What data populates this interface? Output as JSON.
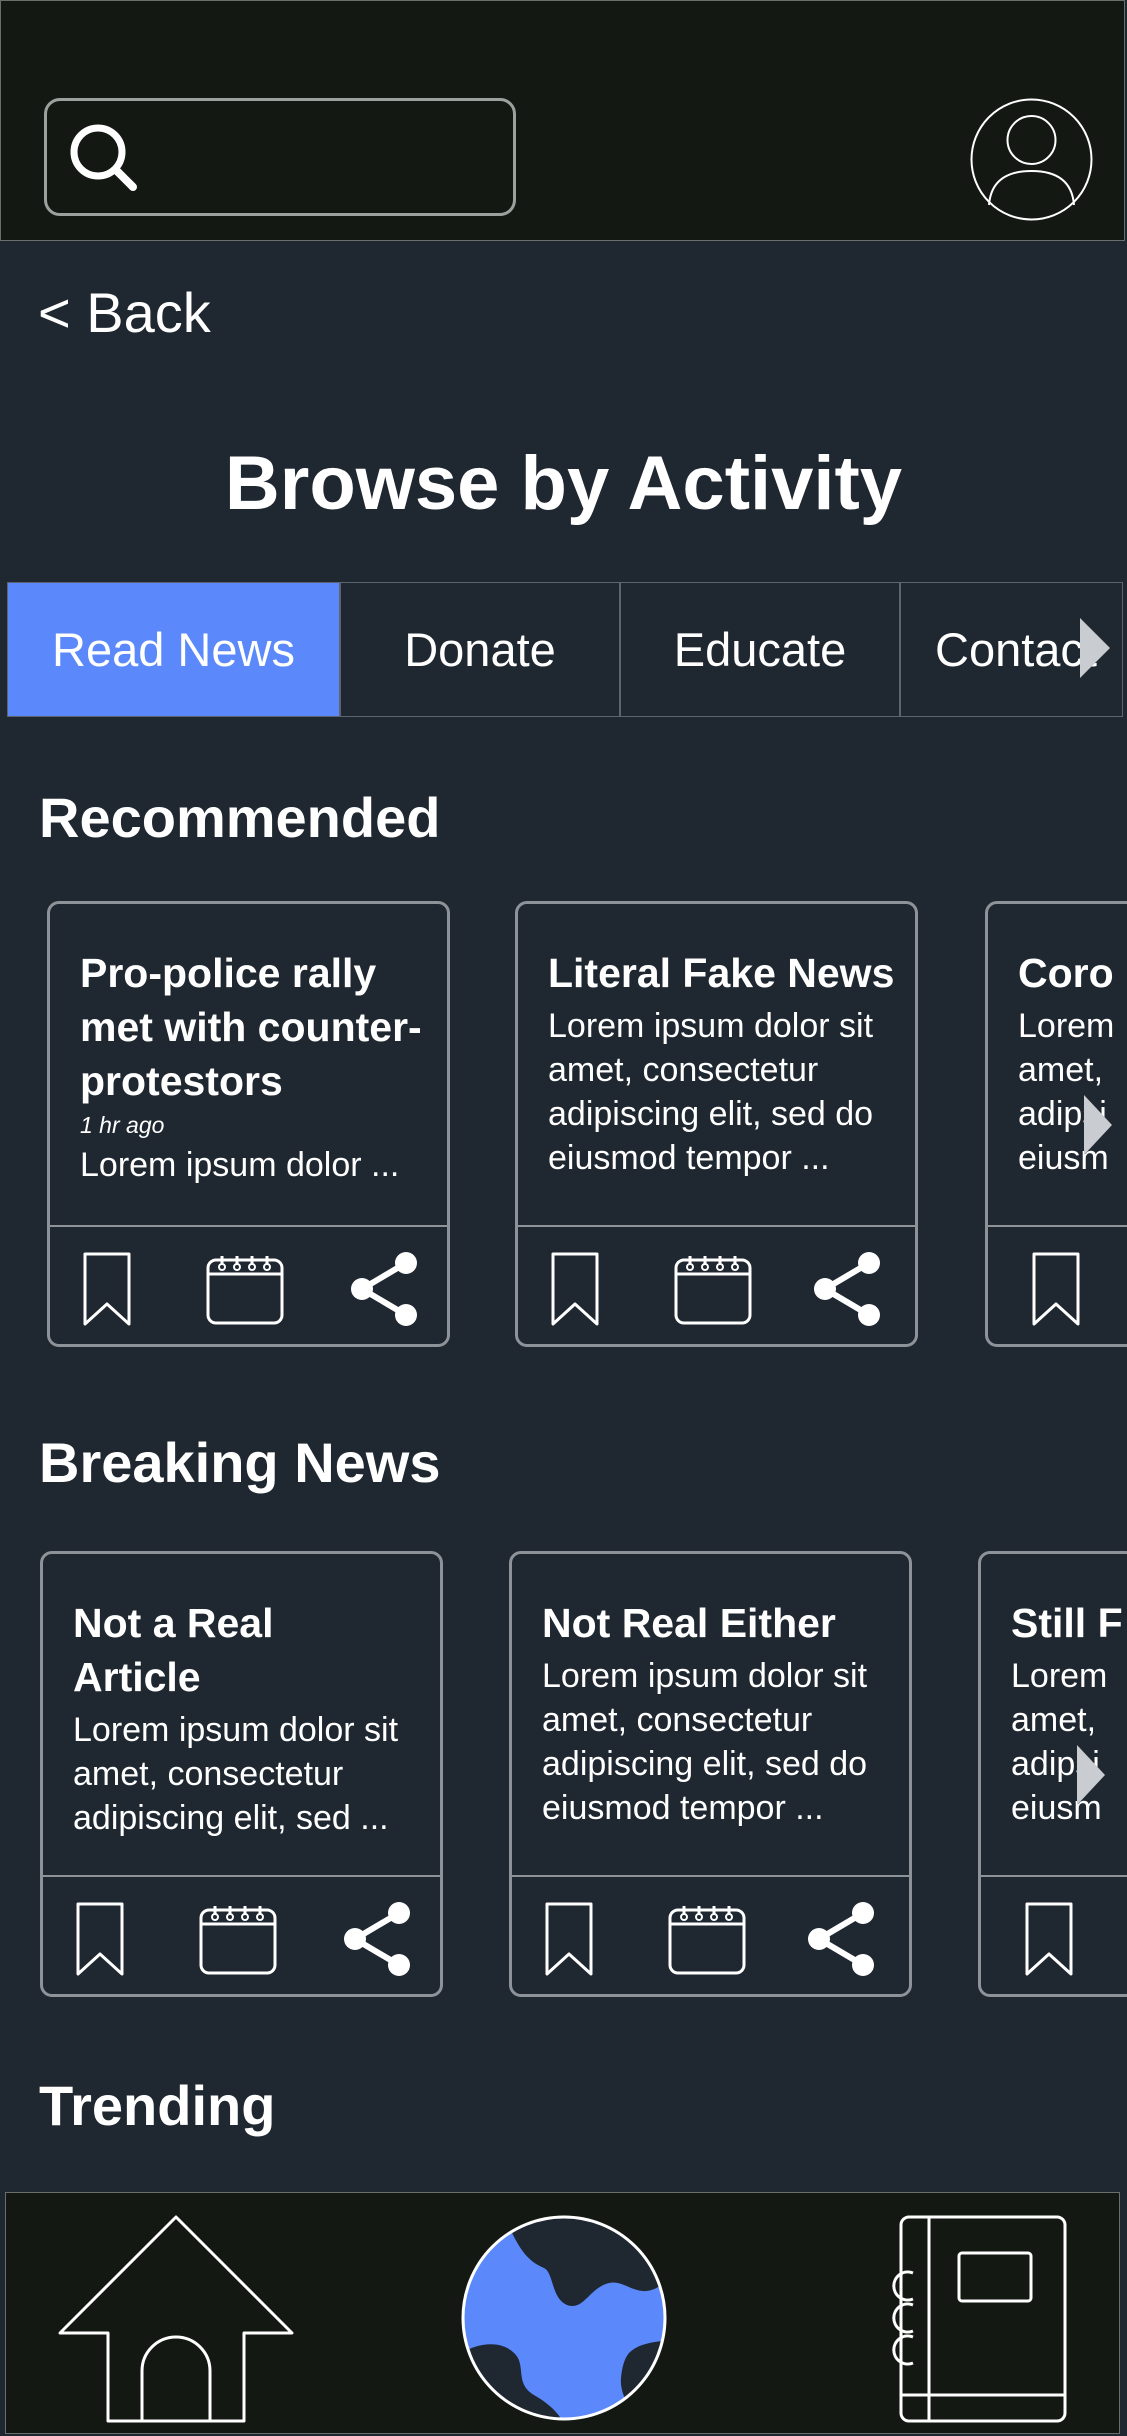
{
  "header": {
    "search_icon": "search-icon",
    "avatar_icon": "user-icon"
  },
  "nav": {
    "back_label": "< Back"
  },
  "page": {
    "title": "Browse by Activity"
  },
  "tabs": [
    {
      "label": "Read News",
      "active": true
    },
    {
      "label": "Donate",
      "active": false
    },
    {
      "label": "Educate",
      "active": false
    },
    {
      "label": "Contact",
      "active": false
    }
  ],
  "sections": {
    "recommended": {
      "title": "Recommended",
      "cards": [
        {
          "title": "Pro-police rally\nmet with counter-\nprotestors",
          "time": "1 hr ago",
          "body": "Lorem ipsum dolor  ..."
        },
        {
          "title": "Literal Fake News",
          "body": "Lorem ipsum dolor sit\namet, consectetur\nadipiscing elit, sed do\neiusmod tempor ..."
        },
        {
          "title": "Coro",
          "body": "Lorem\namet,\nadipsi\neiusm"
        }
      ]
    },
    "breaking": {
      "title": "Breaking News",
      "cards": [
        {
          "title": "Not a Real\nArticle",
          "body": "Lorem ipsum dolor sit\namet, consectetur\nadipiscing elit, sed ..."
        },
        {
          "title": "Not Real Either",
          "body": "Lorem ipsum dolor sit\namet, consectetur\nadipiscing elit, sed do\neiusmod tempor  ..."
        },
        {
          "title": "Still F",
          "body": "Lorem\namet,\nadipsi\neiusm"
        }
      ]
    },
    "trending": {
      "title": "Trending"
    }
  },
  "card_actions": [
    "bookmark-icon",
    "calendar-icon",
    "share-icon"
  ],
  "bottom_nav": [
    "home-icon",
    "globe-icon",
    "notebook-icon"
  ],
  "colors": {
    "background": "#1f2731",
    "bar": "#131813",
    "accent": "#5b88fa",
    "border": "#8e939a"
  }
}
